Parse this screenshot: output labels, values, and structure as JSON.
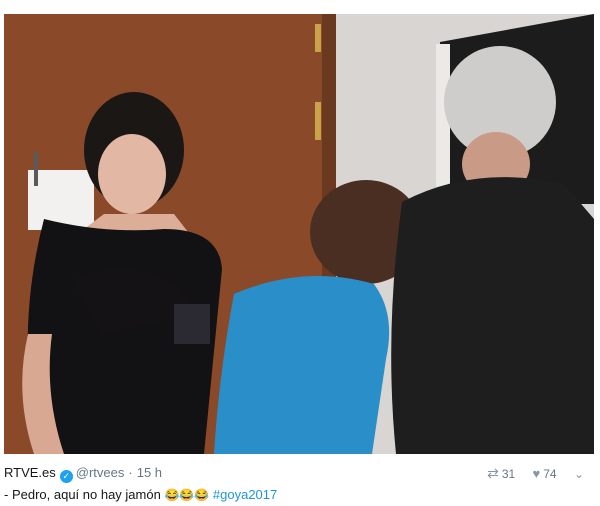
{
  "tweet": {
    "author_name": "RTVE.es",
    "handle": "@rtvees",
    "separator": "·",
    "time": "15 h",
    "verified_icon": "verified-badge-icon",
    "text": "- Pedro, aquí no hay jamón",
    "emojis": "😂😂😂",
    "hashtag": "#goya2017",
    "retweet_icon": "retweet-icon",
    "retweet_count": "31",
    "like_icon": "heart-icon",
    "like_count": "74",
    "more_icon": "chevron-down-icon",
    "link_color": "#1b95e0",
    "verified_color": "#1da1f2"
  }
}
